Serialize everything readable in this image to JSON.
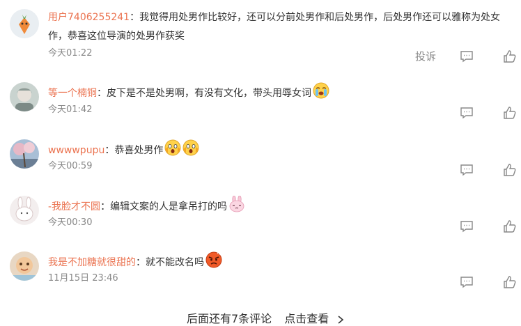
{
  "comments": [
    {
      "user": "用户7406255241",
      "colon": "：",
      "text_line1": "我觉得用处男作比较好，还可以分前处男作和后处男作，后处男作还可以雅称为处女",
      "text_line2": "作，恭喜这位导演的处男作获奖",
      "time": "今天01:22",
      "report": "投诉"
    },
    {
      "user": "等一个楠铜",
      "colon": "：",
      "text_line1": "皮下是不是处男啊，有没有文化，带头用辱女词",
      "time": "今天01:42"
    },
    {
      "user": "wwwwpupu",
      "colon": "：",
      "text_line1": "恭喜处男作",
      "time": "今天00:59"
    },
    {
      "user": "-我脸才不圆",
      "colon": "：",
      "text_line1": "编辑文案的人是拿吊打的吗",
      "time": "今天00:30"
    },
    {
      "user": "我是不加糖就很甜的",
      "colon": "：",
      "text_line1": "就不能改名吗",
      "time": "11月15日 23:46"
    }
  ],
  "footer": {
    "more_text": "后面还有7条评论",
    "view_link": "点击查看"
  },
  "colors": {
    "username": "#eb7350",
    "time": "#888888",
    "text": "#333333"
  }
}
